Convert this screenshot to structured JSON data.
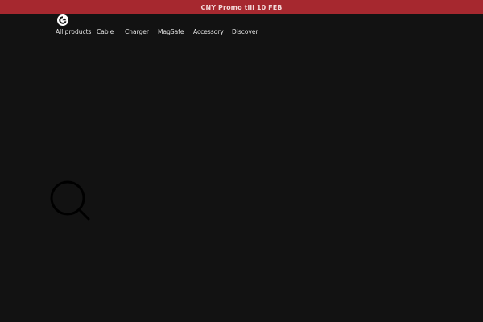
{
  "promo": {
    "text": "CNY Promo till 10 FEB",
    "background": "#a6282f"
  },
  "logo": {
    "icon": "brand-logo-icon"
  },
  "nav": {
    "items": [
      {
        "label": "All products"
      },
      {
        "label": "Cable"
      },
      {
        "label": "Charger"
      },
      {
        "label": "MagSafe"
      },
      {
        "label": "Accessory"
      },
      {
        "label": "Discover"
      }
    ]
  },
  "search": {
    "icon": "search-icon"
  },
  "colors": {
    "page_background": "#121212",
    "nav_text": "#e4e4e4"
  }
}
